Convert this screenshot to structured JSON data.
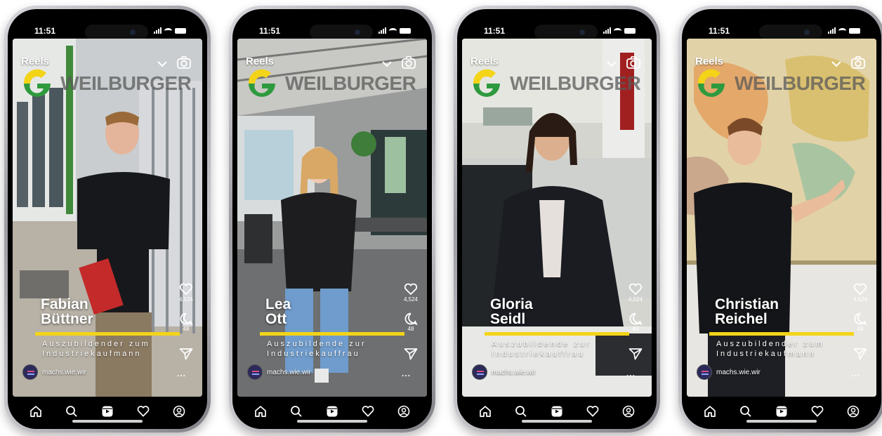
{
  "phones": [
    {
      "time": "11:51",
      "header": {
        "title": "Reels"
      },
      "logo": {
        "wordmark": "WEILBURGER"
      },
      "person": {
        "first_name": "Fabian",
        "last_name": "Büttner"
      },
      "role": {
        "line1": "Auszubildender zum",
        "line2": "Industriekaufmann"
      },
      "actions": {
        "likes": "4,524",
        "comments": "48"
      },
      "account": {
        "handle": "machs.wie.wir"
      },
      "more_label": "..."
    },
    {
      "time": "11:51",
      "header": {
        "title": "Reels"
      },
      "logo": {
        "wordmark": "WEILBURGER"
      },
      "person": {
        "first_name": "Lea",
        "last_name": "Ott"
      },
      "role": {
        "line1": "Auszubildende zur",
        "line2": "Industriekauffrau"
      },
      "actions": {
        "likes": "4,524",
        "comments": "48"
      },
      "account": {
        "handle": "machs.wie.wir"
      },
      "more_label": "..."
    },
    {
      "time": "11:51",
      "header": {
        "title": "Reels"
      },
      "logo": {
        "wordmark": "WEILBURGER"
      },
      "person": {
        "first_name": "Gloria",
        "last_name": "Seidl"
      },
      "role": {
        "line1": "Auszubildende zur",
        "line2": "Industriekauffrau"
      },
      "actions": {
        "likes": "4,524",
        "comments": "48"
      },
      "account": {
        "handle": "machs.wie.wir"
      },
      "more_label": "..."
    },
    {
      "time": "11:51",
      "header": {
        "title": "Reels"
      },
      "logo": {
        "wordmark": "WEILBURGER"
      },
      "person": {
        "first_name": "Christian",
        "last_name": "Reichel"
      },
      "role": {
        "line1": "Auszubildender zum",
        "line2": "Industriekaufmann"
      },
      "actions": {
        "likes": "4,524",
        "comments": "48"
      },
      "account": {
        "handle": "machs.wie.wir"
      },
      "more_label": "..."
    }
  ],
  "tabbar": {
    "icons": [
      "home-icon",
      "search-icon",
      "reels-icon",
      "heart-icon",
      "profile-icon"
    ]
  },
  "colors": {
    "accent_bar": "#f3d418",
    "logo_yellow": "#f3d418",
    "logo_green": "#2e9a3e"
  }
}
